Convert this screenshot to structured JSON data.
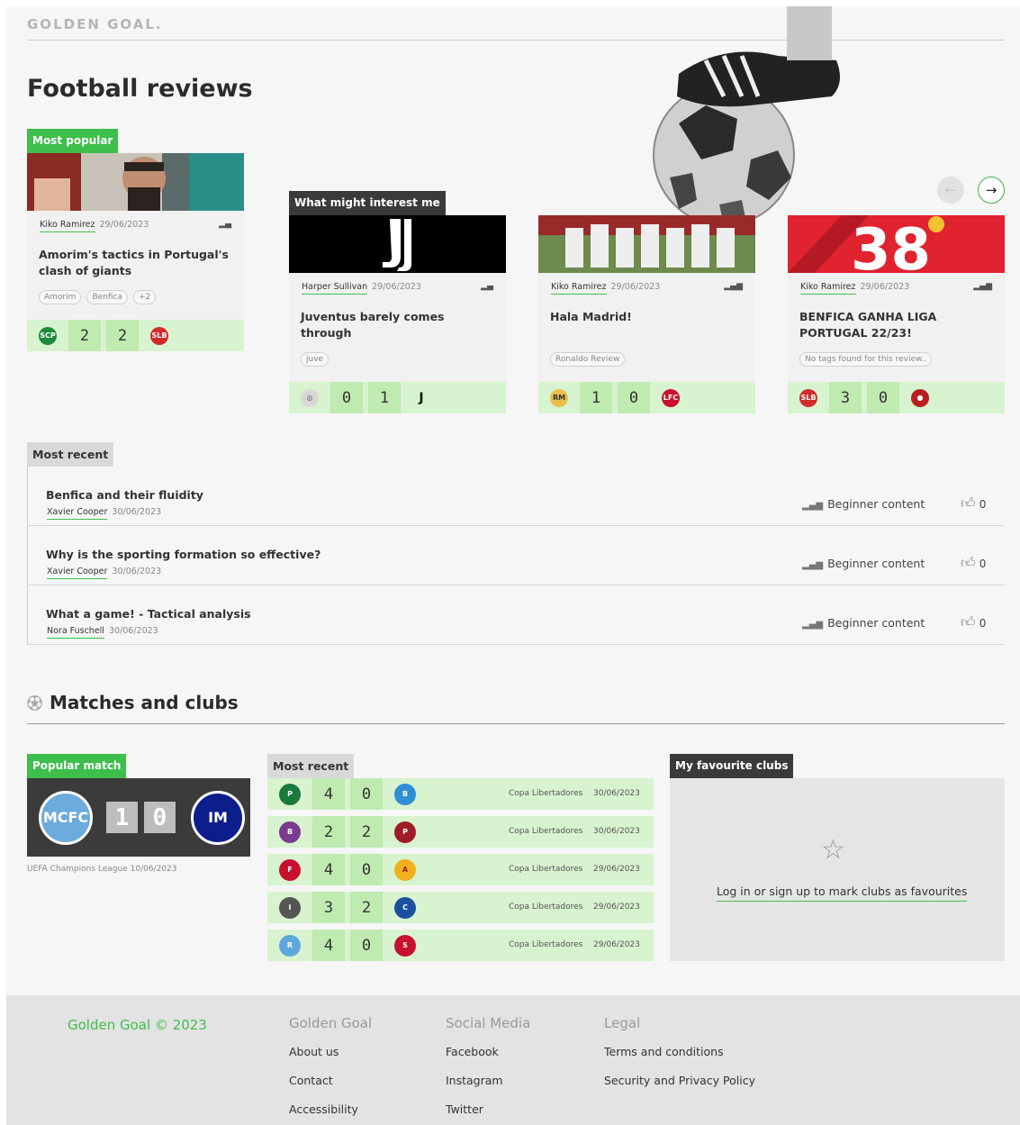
{
  "brand": "GOLDEN GOAL.",
  "page_title": "Football reviews",
  "carousel": {
    "prev_icon": "arrow-left-icon",
    "next_icon": "arrow-right-icon",
    "cards": [
      {
        "label": "Most popular",
        "author": "Kiko Ramirez",
        "date": "29/06/2023",
        "title": "Amorim's tactics in Portugal's clash of giants",
        "tags": [
          "Amorim",
          "Benfica",
          "+2"
        ],
        "home_score": "2",
        "away_score": "2",
        "home_crest": "sporting-crest-icon",
        "away_crest": "benfica-crest-icon"
      },
      {
        "label": "What might interest me",
        "author": "Harper Sullivan",
        "date": "29/06/2023",
        "title": "Juventus barely comes through",
        "tags": [
          "juve"
        ],
        "home_score": "0",
        "away_score": "1",
        "home_crest": "club-crest-icon",
        "away_crest": "juventus-crest-icon"
      },
      {
        "author": "Kiko Ramirez",
        "date": "29/06/2023",
        "title": "Hala Madrid!",
        "tags": [
          "Ronaldo Review"
        ],
        "home_score": "1",
        "away_score": "0",
        "home_crest": "real-madrid-crest-icon",
        "away_crest": "liverpool-crest-icon"
      },
      {
        "author": "Kiko Ramirez",
        "date": "29/06/2023",
        "title": "BENFICA GANHA LIGA PORTUGAL 22/23!",
        "tags": [
          "No tags found for this review.."
        ],
        "home_score": "3",
        "away_score": "0",
        "home_crest": "benfica-crest-icon",
        "away_crest": "club-crest-icon"
      }
    ]
  },
  "most_recent": {
    "label": "Most recent",
    "rows": [
      {
        "title": "Benfica and their fluidity",
        "author": "Xavier Cooper",
        "date": "30/06/2023",
        "level": "Beginner content",
        "likes": "0"
      },
      {
        "title": "Why is the sporting formation so effective?",
        "author": "Xavier Cooper",
        "date": "30/06/2023",
        "level": "Beginner content",
        "likes": "0"
      },
      {
        "title": "What a game! - Tactical analysis",
        "author": "Nora Fuschell",
        "date": "30/06/2023",
        "level": "Beginner content",
        "likes": "0"
      }
    ]
  },
  "matches": {
    "heading": "Matches and clubs",
    "popular": {
      "label": "Popular match",
      "home_score": "1",
      "away_score": "0",
      "home_crest": "manchester-city-crest-icon",
      "away_crest": "inter-crest-icon",
      "competition": "UEFA Champions League",
      "date": "10/06/2023"
    },
    "recent": {
      "label": "Most recent",
      "rows": [
        {
          "home": "4",
          "away": "0",
          "competition": "Copa Libertadores",
          "date": "30/06/2023"
        },
        {
          "home": "2",
          "away": "2",
          "competition": "Copa Libertadores",
          "date": "30/06/2023"
        },
        {
          "home": "4",
          "away": "0",
          "competition": "Copa Libertadores",
          "date": "29/06/2023"
        },
        {
          "home": "3",
          "away": "2",
          "competition": "Copa Libertadores",
          "date": "29/06/2023"
        },
        {
          "home": "4",
          "away": "0",
          "competition": "Copa Libertadores",
          "date": "29/06/2023"
        }
      ]
    },
    "favourites": {
      "label": "My favourite clubs",
      "link": "Log in or sign up to mark clubs as favourites"
    }
  },
  "footer": {
    "brand": "Golden Goal © 2023",
    "columns": [
      {
        "heading": "Golden Goal",
        "links": [
          "About us",
          "Contact",
          "Accessibility"
        ]
      },
      {
        "heading": "Social Media",
        "links": [
          "Facebook",
          "Instagram",
          "Twitter"
        ]
      },
      {
        "heading": "Legal",
        "links": [
          "Terms and conditions",
          "Security and Privacy Policy"
        ]
      }
    ]
  },
  "colors": {
    "accent": "#3ebe4b",
    "score_bg": "#d8f3cf",
    "score_cell": "#bfeab0"
  }
}
